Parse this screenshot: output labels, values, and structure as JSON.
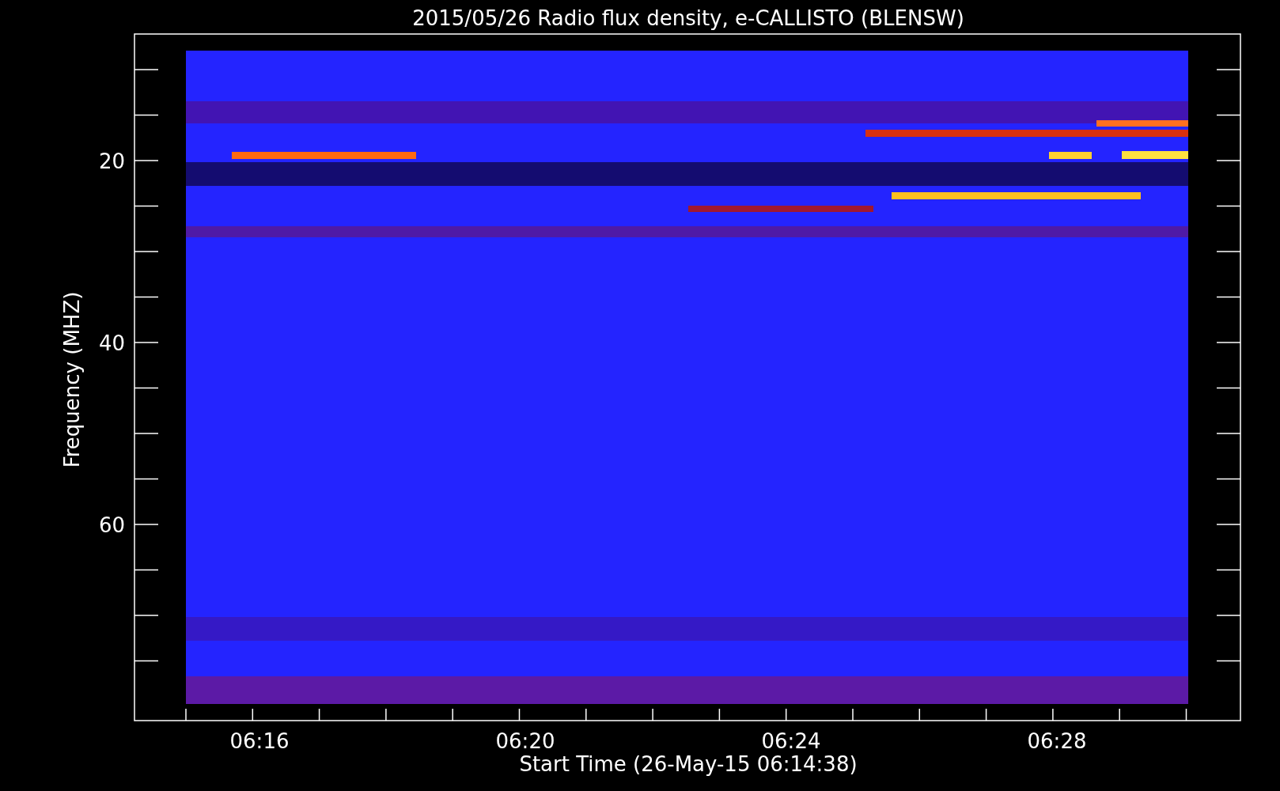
{
  "title": "2015/05/26  Radio flux density, e-CALLISTO (BLENSW)",
  "ylabel": "Frequency (MHZ)",
  "xlabel": "Start Time (26-May-15 06:14:38)",
  "yticks": [
    "20",
    "40",
    "60"
  ],
  "xticks": [
    "06:16",
    "06:20",
    "06:24",
    "06:28"
  ]
}
